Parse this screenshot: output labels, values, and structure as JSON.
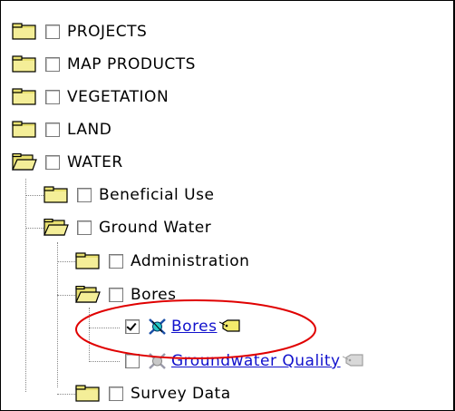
{
  "tree": {
    "projects": "PROJECTS",
    "map_products": "MAP PRODUCTS",
    "vegetation": "VEGETATION",
    "land": "LAND",
    "water": "WATER",
    "beneficial_use": "Beneficial Use",
    "ground_water": "Ground Water",
    "administration": "Administration",
    "bores_folder": "Bores",
    "bores_layer": "Bores",
    "groundwater_quality_layer": "Groundwater Quality",
    "survey_data": "Survey Data"
  },
  "colors": {
    "folder": "#e8e070",
    "link": "#1111cc",
    "highlight_ellipse": "#e00000"
  }
}
